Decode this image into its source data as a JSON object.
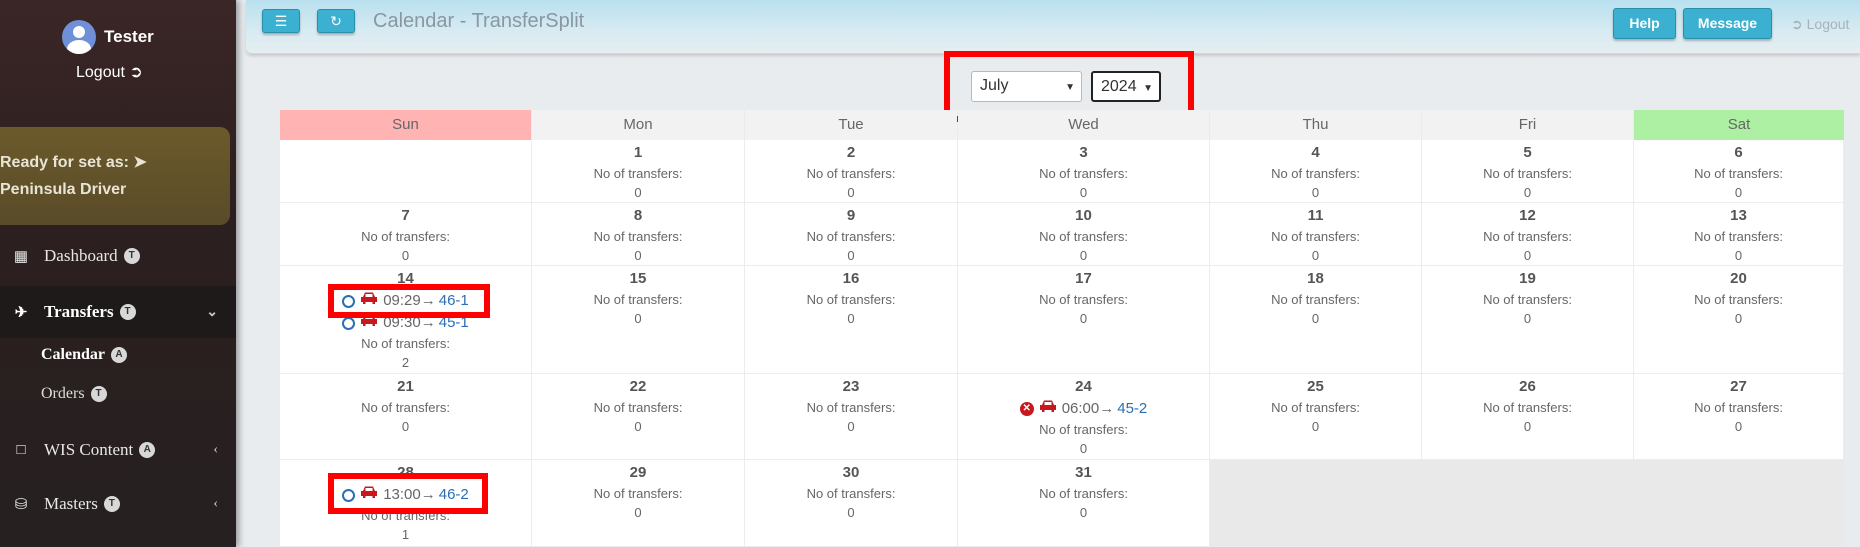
{
  "sidebar": {
    "username": "Tester",
    "logout": "Logout",
    "ready_line1": "Ready for set as:",
    "ready_line2": "Peninsula Driver",
    "items": [
      {
        "label": "Dashboard",
        "badge": "T"
      },
      {
        "label": "Transfers",
        "badge": "T"
      },
      {
        "label": "WIS Content",
        "badge": "A"
      },
      {
        "label": "Masters",
        "badge": "T"
      }
    ],
    "subitems": [
      {
        "label": "Calendar",
        "badge": "A"
      },
      {
        "label": "Orders",
        "badge": "T"
      }
    ]
  },
  "header": {
    "title": "Calendar - TransferSplit",
    "help": "Help",
    "message": "Message",
    "logout": "Logout"
  },
  "selector": {
    "month": "July",
    "year": "2024"
  },
  "calendar": {
    "weekdays": [
      "Sun",
      "Mon",
      "Tue",
      "Wed",
      "Thu",
      "Fri",
      "Sat"
    ],
    "no_label": "No of transfers:",
    "days": {
      "1": "0",
      "2": "0",
      "3": "0",
      "4": "0",
      "5": "0",
      "6": "0",
      "7": "0",
      "8": "0",
      "9": "0",
      "10": "0",
      "11": "0",
      "12": "0",
      "13": "0",
      "14": "2",
      "15": "0",
      "16": "0",
      "17": "0",
      "18": "0",
      "19": "0",
      "20": "0",
      "21": "0",
      "22": "0",
      "23": "0",
      "24": "0",
      "25": "0",
      "26": "0",
      "27": "0",
      "28": "1",
      "29": "0",
      "30": "0",
      "31": "0"
    },
    "transfers": {
      "t14a": {
        "time": "09:29",
        "route": "46-1"
      },
      "t14b": {
        "time": "09:30",
        "route": "45-1"
      },
      "t24": {
        "time": "06:00",
        "route": "45-2"
      },
      "t28": {
        "time": "13:00",
        "route": "46-2"
      }
    }
  },
  "colors": {
    "accent": "#3bb0d0",
    "sunday": "#ffb3b3",
    "saturday": "#aef0a3",
    "highlight": "#ff0000",
    "link": "#2a6fb5",
    "cancel": "#c9171e"
  }
}
